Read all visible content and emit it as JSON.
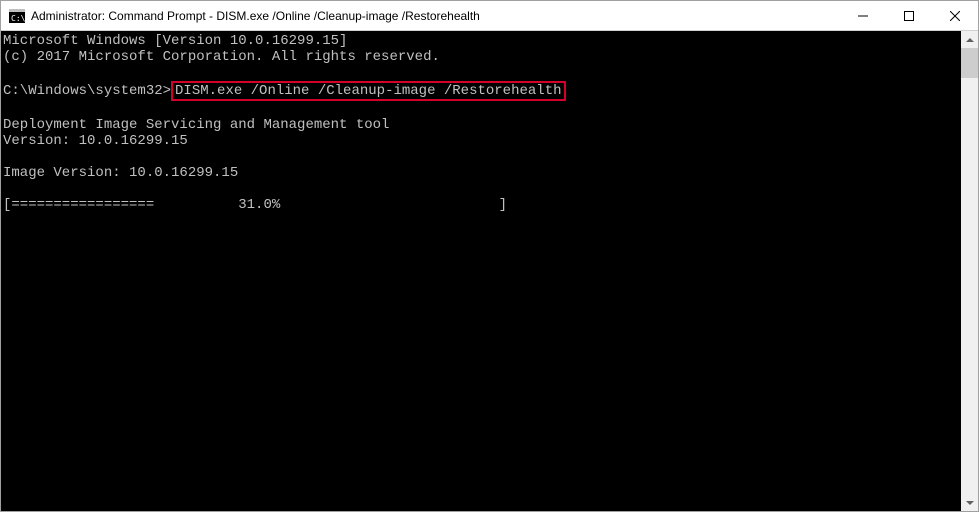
{
  "titlebar": {
    "title": "Administrator: Command Prompt - DISM.exe  /Online /Cleanup-image /Restorehealth"
  },
  "console": {
    "line1": "Microsoft Windows [Version 10.0.16299.15]",
    "line2": "(c) 2017 Microsoft Corporation. All rights reserved.",
    "prompt": "C:\\Windows\\system32>",
    "command": "DISM.exe /Online /Cleanup-image /Restorehealth",
    "tool_line1": "Deployment Image Servicing and Management tool",
    "tool_line2": "Version: 10.0.16299.15",
    "image_version": "Image Version: 10.0.16299.15",
    "progress": "[=================          31.0%                          ] "
  }
}
